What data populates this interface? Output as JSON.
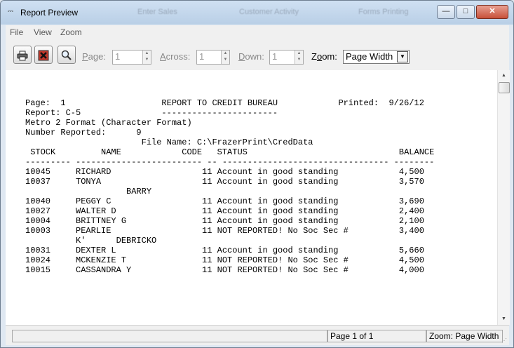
{
  "window": {
    "title": "Report Preview",
    "background_titles": [
      "Enter Sales",
      "Customer Activity",
      "Forms Printing"
    ],
    "controls": {
      "minimize": "—",
      "maximize": "□",
      "close": "✕"
    }
  },
  "menu": [
    "File",
    "View",
    "Zoom"
  ],
  "toolbar": {
    "print_icon": "printer-icon",
    "stop_icon": "stop-icon",
    "magnify_icon": "magnifier-icon",
    "page_label_underline": "P",
    "page_label_rest": "age:",
    "page_value": "1",
    "across_label_underline": "A",
    "across_label_rest": "cross:",
    "across_value": "1",
    "down_label_underline": "D",
    "down_label_rest": "own:",
    "down_value": "1",
    "zoom_label_start": "Z",
    "zoom_label_underline": "o",
    "zoom_label_rest": "om:",
    "zoom_value": "Page Width"
  },
  "report": {
    "line1": "Page:  1                   REPORT TO CREDIT BUREAU            Printed:  9/26/12",
    "line2": "Report: C-5                -----------------------",
    "line3": "Metro 2 Format (Character Format)",
    "line4": "Number Reported:      9",
    "line5": "                       File Name: C:\\FrazerPrint\\CredData",
    "line6": " STOCK         NAME            CODE   STATUS                              BALANCE",
    "line7": "--------- ------------------------- -- --------------------------------- --------",
    "line8": "10045     RICHARD                  11 Account in good standing            4,500",
    "line9": "10037     TONYA                    11 Account in good standing            3,570",
    "line10": "                    BARRY",
    "line11": "10040     PEGGY C                  11 Account in good standing            3,690",
    "line12": "10027     WALTER D                 11 Account in good standing            2,400",
    "line13": "10004     BRITTNEY G               11 Account in good standing            2,100",
    "line14": "10003     PEARLIE                  11 NOT REPORTED! No Soc Sec #          3,400",
    "line15": "          K'      DEBRICKO",
    "line16": "10031     DEXTER L                 11 Account in good standing            5,660",
    "line17": "10024     MCKENZIE T               11 NOT REPORTED! No Soc Sec #          4,500",
    "line18": "10015     CASSANDRA Y              11 NOT REPORTED! No Soc Sec #          4,000"
  },
  "statusbar": {
    "page_info": "Page 1 of 1",
    "zoom_info": "Zoom: Page Width"
  }
}
